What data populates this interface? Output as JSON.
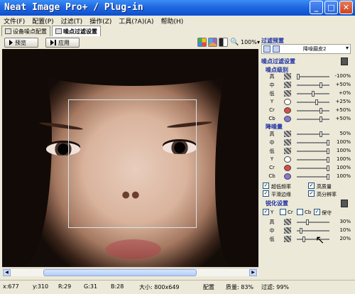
{
  "window": {
    "title": "Neat Image Pro+ / Plug-in"
  },
  "menu": [
    "文件(F)",
    "配置(P)",
    "过滤(T)",
    "操作(Z)",
    "工具(?A)(A)",
    "帮助(H)"
  ],
  "tabs": [
    {
      "label": "设备噪点配置",
      "active": false
    },
    {
      "label": "噪点过滤设置",
      "active": true
    }
  ],
  "toolbar": {
    "preview_label": "预览",
    "apply_label": "应用",
    "zoom_label": "100%"
  },
  "filter_preset": {
    "title": "过滤预置",
    "selected": "降噪磨皮2"
  },
  "noise_filter": {
    "title": "噪点过滤设置",
    "noise_level": {
      "title": "噪点级别",
      "rows": [
        {
          "label": "高",
          "value": "-100%",
          "kind": "pattern",
          "color": ""
        },
        {
          "label": "中",
          "value": "+50%",
          "kind": "pattern",
          "color": ""
        },
        {
          "label": "低",
          "value": "+0%",
          "kind": "pattern",
          "color": ""
        },
        {
          "label": "Y",
          "value": "+25%",
          "kind": "circle",
          "color": "#ffffff"
        },
        {
          "label": "Cr",
          "value": "+50%",
          "kind": "circle",
          "color": "#d94a4a"
        },
        {
          "label": "Cb",
          "value": "+50%",
          "kind": "circle",
          "color": "#8878d8"
        }
      ]
    },
    "noise_reduction": {
      "title": "降噪量",
      "rows": [
        {
          "label": "高",
          "value": "50%",
          "kind": "pattern",
          "color": ""
        },
        {
          "label": "中",
          "value": "100%",
          "kind": "pattern",
          "color": ""
        },
        {
          "label": "低",
          "value": "100%",
          "kind": "pattern",
          "color": ""
        },
        {
          "label": "Y",
          "value": "100%",
          "kind": "circle",
          "color": "#ffffff"
        },
        {
          "label": "Cr",
          "value": "100%",
          "kind": "circle",
          "color": "#d94a4a"
        },
        {
          "label": "Cb",
          "value": "100%",
          "kind": "circle",
          "color": "#8878d8"
        }
      ]
    },
    "options": [
      {
        "label": "超低频率",
        "checked": true
      },
      {
        "label": "高质量",
        "checked": true
      },
      {
        "label": "平滑边缘",
        "checked": true
      },
      {
        "label": "高分辨率",
        "checked": true
      }
    ]
  },
  "sharpen": {
    "title": "锐化设置",
    "channels": [
      {
        "label": "Y",
        "checked": true
      },
      {
        "label": "Cr",
        "checked": false
      },
      {
        "label": "Cb",
        "checked": false
      },
      {
        "label": "保守",
        "checked": true
      }
    ],
    "rows": [
      {
        "label": "高",
        "value": "30%"
      },
      {
        "label": "中",
        "value": "10%"
      },
      {
        "label": "低",
        "value": "20%"
      }
    ]
  },
  "status": {
    "x": "x:677",
    "y": "y:310",
    "r": "R:29",
    "g": "G:31",
    "b": "B:28",
    "size": "大小: 800x649",
    "profile": "配置",
    "quality": "质量: 83%",
    "filter": "过滤: 99%"
  },
  "colors": {
    "title_bar": "#2168e0",
    "section_title": "#1b2fa0",
    "face_bg": "#140c08"
  }
}
